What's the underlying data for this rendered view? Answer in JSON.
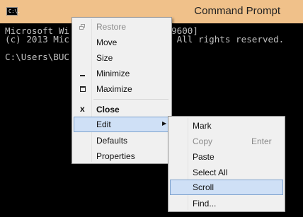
{
  "window": {
    "title": "Command Prompt",
    "icon": "cmd-app-icon",
    "icon_text": "C:\\."
  },
  "console": {
    "lines": [
      "Microsoft Wi                 3.9600]",
      "(c) 2013 Mic                 n. All rights reserved.",
      "",
      "C:\\Users\\BUC"
    ]
  },
  "system_menu": {
    "restore": "Restore",
    "move": "Move",
    "size": "Size",
    "minimize": "Minimize",
    "maximize": "Maximize",
    "close": "Close",
    "edit": "Edit",
    "defaults": "Defaults",
    "properties": "Properties",
    "close_icon_glyph": "x",
    "submenu_arrow": "▶"
  },
  "edit_menu": {
    "mark": "Mark",
    "copy": "Copy",
    "copy_shortcut": "Enter",
    "paste": "Paste",
    "select_all": "Select All",
    "scroll": "Scroll",
    "find": "Find..."
  },
  "colors": {
    "title_bar": "#f0c18a",
    "console_bg": "#000000",
    "console_text": "#c0c0c0",
    "menu_bg": "#f0f0f0",
    "highlight_bg": "#cfe0f6",
    "highlight_border": "#7da2ce"
  }
}
